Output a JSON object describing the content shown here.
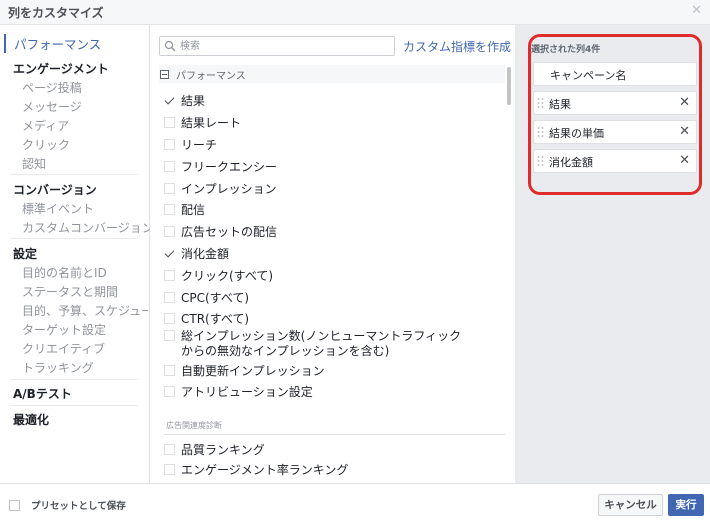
{
  "dialog": {
    "title": "列をカスタマイズ"
  },
  "nav": {
    "active": "パフォーマンス",
    "engagement": {
      "label": "エンゲージメント",
      "items": [
        "ページ投稿",
        "メッセージ",
        "メディア",
        "クリック",
        "認知"
      ]
    },
    "conversion": {
      "label": "コンバージョン",
      "items": [
        "標準イベント",
        "カスタムコンバージョン"
      ]
    },
    "settings": {
      "label": "設定",
      "items": [
        "目的の名前とID",
        "ステータスと期間",
        "目的、予算、スケジュール",
        "ターゲット設定",
        "クリエイティブ",
        "トラッキング"
      ]
    },
    "ab_test": "A/Bテスト",
    "optimization": "最適化"
  },
  "search": {
    "placeholder": "検索",
    "value": ""
  },
  "custom_metric_link": "カスタム指標を作成",
  "section": {
    "title": "パフォーマンス"
  },
  "metrics": [
    {
      "label": "結果",
      "checked": true
    },
    {
      "label": "結果レート",
      "checked": false
    },
    {
      "label": "リーチ",
      "checked": false
    },
    {
      "label": "フリークエンシー",
      "checked": false
    },
    {
      "label": "インプレッション",
      "checked": false
    },
    {
      "label": "配信",
      "checked": false
    },
    {
      "label": "広告セットの配信",
      "checked": false
    },
    {
      "label": "消化金額",
      "checked": true
    },
    {
      "label": "クリック(すべて)",
      "checked": false
    },
    {
      "label": "CPC(すべて)",
      "checked": false
    },
    {
      "label": "CTR(すべて)",
      "checked": false
    },
    {
      "label": "総インプレッション数(ノンヒューマントラフィック",
      "label2": "からの無効なインプレッションを含む)",
      "checked": false
    },
    {
      "label": "自動更新インプレッション",
      "checked": false
    },
    {
      "label": "アトリビューション設定",
      "checked": false
    }
  ],
  "relevance": {
    "title": "広告関連度診断",
    "items": [
      {
        "label": "品質ランキング",
        "checked": false
      },
      {
        "label": "エンゲージメント率ランキング",
        "checked": false
      }
    ]
  },
  "selected": {
    "title": "選択された列4件",
    "fixed": "キャンペーン名",
    "items": [
      "結果",
      "結果の単価",
      "消化金額"
    ]
  },
  "footer": {
    "save_preset": "プリセットとして保存",
    "cancel": "キャンセル",
    "run": "実行"
  },
  "colors": {
    "accent": "#4267b2",
    "highlight_frame": "#e02b2b"
  }
}
